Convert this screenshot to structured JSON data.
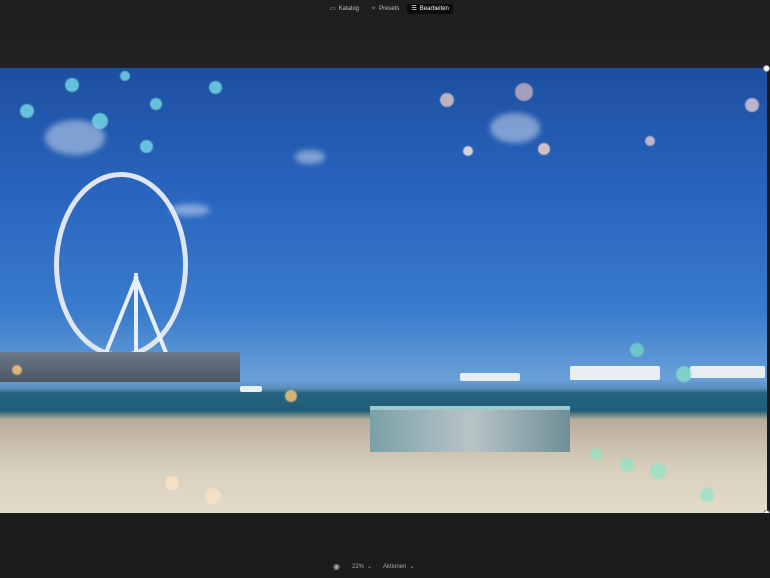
{
  "header": {
    "tabs": [
      {
        "label": "Katalog",
        "icon": "folder-icon",
        "active": false
      },
      {
        "label": "Presets",
        "icon": "sparkle-icon",
        "active": false
      },
      {
        "label": "Bearbeiten",
        "icon": "sliders-icon",
        "active": true
      }
    ]
  },
  "footer": {
    "preview_icon": "eye-icon",
    "zoom": "22%",
    "actions": "Aktionen"
  }
}
